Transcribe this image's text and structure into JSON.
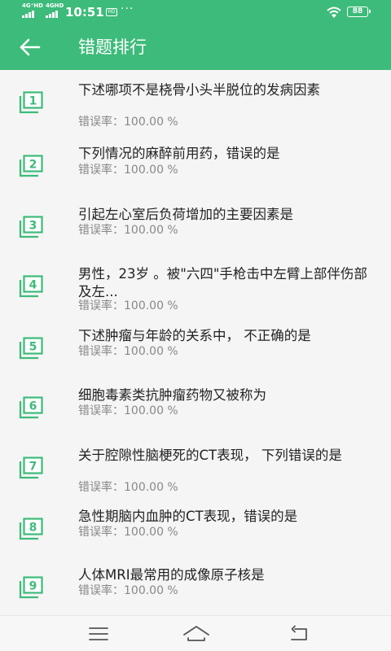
{
  "status_bar": {
    "signal1_tag": "4G⁺HD",
    "signal2_tag": "4GHD",
    "time": "10:51",
    "hd_badge": "HD",
    "dots": "···",
    "battery": "88"
  },
  "header": {
    "title": "错题排行",
    "back_icon": "arrow-left-icon"
  },
  "colors": {
    "accent": "#3dbb7a",
    "text": "#222222",
    "subtext": "#888888",
    "background": "#f5f5f5"
  },
  "items": [
    {
      "num": "1",
      "text": "下述哪项不是桡骨小头半脱位的发病因素",
      "rate": "错误率：100.00 %"
    },
    {
      "num": "2",
      "text": "下列情况的麻醉前用药，错误的是",
      "rate": "错误率：100.00 %"
    },
    {
      "num": "3",
      "text": "引起左心室后负荷增加的主要因素是",
      "rate": "错误率：100.00 %"
    },
    {
      "num": "4",
      "text": "男性，23岁 。被\"六四\"手枪击中左臂上部伴伤部及左...",
      "rate": "错误率：100.00 %"
    },
    {
      "num": "5",
      "text": "下述肿瘤与年龄的关系中， 不正确的是",
      "rate": "错误率：100.00 %"
    },
    {
      "num": "6",
      "text": "细胞毒素类抗肿瘤药物又被称为",
      "rate": "错误率：100.00 %"
    },
    {
      "num": "7",
      "text": "关于腔隙性脑梗死的CT表现， 下列错误的是",
      "rate": "错误率：100.00 %"
    },
    {
      "num": "8",
      "text": "急性期脑内血肿的CT表现，错误的是",
      "rate": "错误率：100.00 %"
    },
    {
      "num": "9",
      "text": "人体MRI最常用的成像原子核是",
      "rate": "错误率：100.00 %"
    }
  ],
  "nav_bar": {
    "menu_icon": "menu-icon",
    "home_icon": "home-icon",
    "back_icon": "back-icon"
  }
}
